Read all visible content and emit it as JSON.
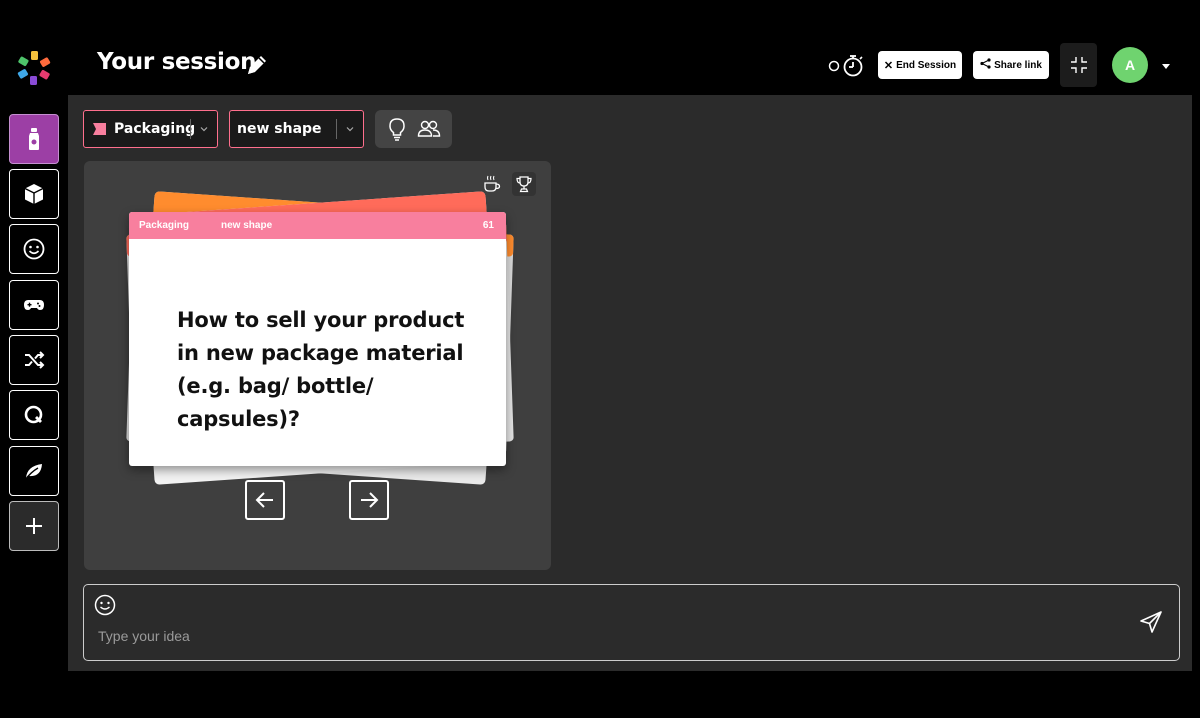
{
  "header": {
    "title": "Your session",
    "end_session_label": "End Session",
    "share_link_label": "Share link",
    "avatar_initial": "A"
  },
  "sidebar": {
    "items": [
      {
        "icon": "bottle-icon",
        "active": true
      },
      {
        "icon": "box-icon",
        "active": false
      },
      {
        "icon": "smiley-icon",
        "active": false
      },
      {
        "icon": "gamepad-icon",
        "active": false
      },
      {
        "icon": "shuffle-icon",
        "active": false
      },
      {
        "icon": "q-icon",
        "active": false
      },
      {
        "icon": "leaf-icon",
        "active": false
      },
      {
        "icon": "plus-icon",
        "active": false
      }
    ]
  },
  "toolbar": {
    "category_value": "Packaging",
    "subcategory_value": "new shape"
  },
  "card": {
    "category": "Packaging",
    "subcategory": "new shape",
    "number": "61",
    "question": "How to sell your product in new package material (e.g. bag/ bottle/ capsules)?"
  },
  "input": {
    "placeholder": "Type your idea"
  },
  "colors": {
    "accent_pink": "#f87f9e",
    "active_purple": "#9c3fa5",
    "avatar_green": "#6fd36f",
    "card_orange": "#ff8c2e",
    "card_coral": "#ff6b5a"
  }
}
